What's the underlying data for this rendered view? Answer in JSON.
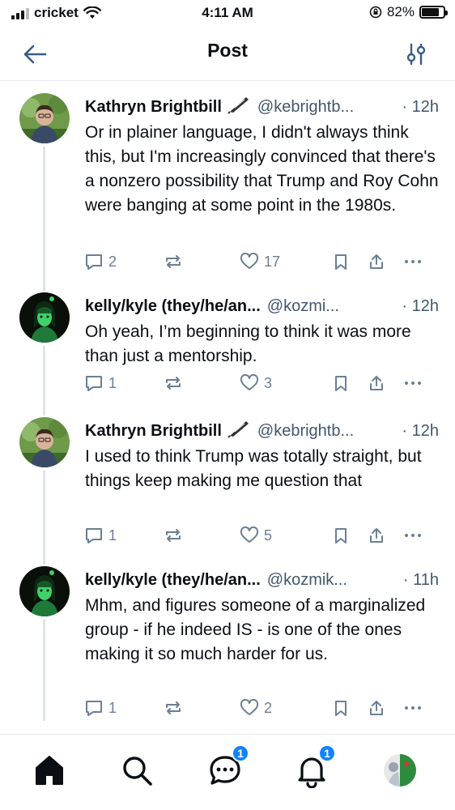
{
  "status_bar": {
    "carrier": "cricket",
    "time": "4:11 AM",
    "battery_percent": "82%",
    "battery_level": 0.82
  },
  "header": {
    "title": "Post"
  },
  "posts": [
    {
      "author": "Kathryn Brightbill",
      "badge_icon": "quill-pen-icon",
      "handle": "@kebrightb...",
      "time": "· 12h",
      "text": "Or in plainer language, I didn't always think this, but I'm increasingly convinced that there's a nonzero possibility that Trump and Roy Cohn were banging at some point in the 1980s.",
      "replies": "2",
      "reposts": "",
      "likes": "17"
    },
    {
      "author": "kelly/kyle (they/he/an...",
      "handle": "@kozmi...",
      "time": "· 12h",
      "text": "Oh yeah, I’m beginning to think it was more than just a mentorship.",
      "replies": "1",
      "reposts": "",
      "likes": "3"
    },
    {
      "author": "Kathryn Brightbill",
      "badge_icon": "quill-pen-icon",
      "handle": "@kebrightb...",
      "time": "· 12h",
      "text": "I used to think Trump was totally straight, but things keep making me question that",
      "replies": "1",
      "reposts": "",
      "likes": "5"
    },
    {
      "author": "kelly/kyle (they/he/an...",
      "handle": "@kozmik...",
      "time": "· 11h",
      "text": "Mhm, and figures someone of a marginalized group - if he indeed IS - is one of the ones making it so much harder for us.",
      "replies": "1",
      "reposts": "",
      "likes": "2"
    }
  ],
  "bottom_nav": {
    "chat_badge": "1",
    "notifications_badge": "1"
  },
  "colors": {
    "accent": "#1083fe",
    "muted_text": "#42576c",
    "icon_gray": "#6b7f94"
  }
}
